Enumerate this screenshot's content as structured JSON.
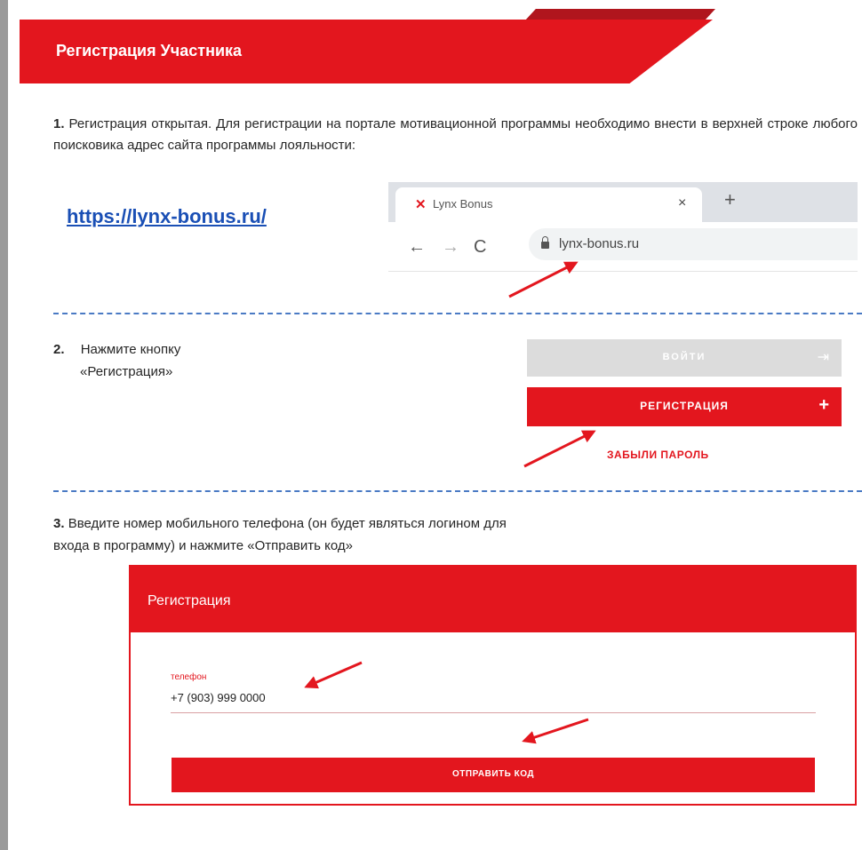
{
  "banner": {
    "title": "Регистрация Участника"
  },
  "step1": {
    "number": "1.",
    "text": "Регистрация открытая. Для регистрации на портале мотивационной программы необходимо внести в верхней строке любого поисковика адрес сайта программы лояльности:",
    "link": "https://lynx-bonus.ru/"
  },
  "browser": {
    "tab_title": "Lynx Bonus",
    "favicon": "✕",
    "close_icon": "×",
    "new_tab_icon": "+",
    "back_icon": "←",
    "forward_icon": "→",
    "reload_icon": "C",
    "url": "lynx-bonus.ru"
  },
  "step2": {
    "number": "2.",
    "line1": "Нажмите кнопку",
    "line2": "«Регистрация»",
    "login_button": "ВОЙТИ",
    "login_icon": "⇥",
    "register_button": "РЕГИСТРАЦИЯ",
    "register_icon": "+",
    "forgot_link": "ЗАБЫЛИ ПАРОЛЬ"
  },
  "step3": {
    "number": "3.",
    "line1": "Введите номер мобильного телефона (он будет являться логином для",
    "line2": "входа в программу) и нажмите «Отправить код»"
  },
  "modal": {
    "title": "Регистрация",
    "phone_label": "телефон",
    "phone_value": "+7 (903) 999 0000",
    "send_button": "ОТПРАВИТЬ КОД"
  },
  "colors": {
    "accent": "#e3161e",
    "link": "#1a4fb5",
    "divider": "#4a7ac4"
  }
}
